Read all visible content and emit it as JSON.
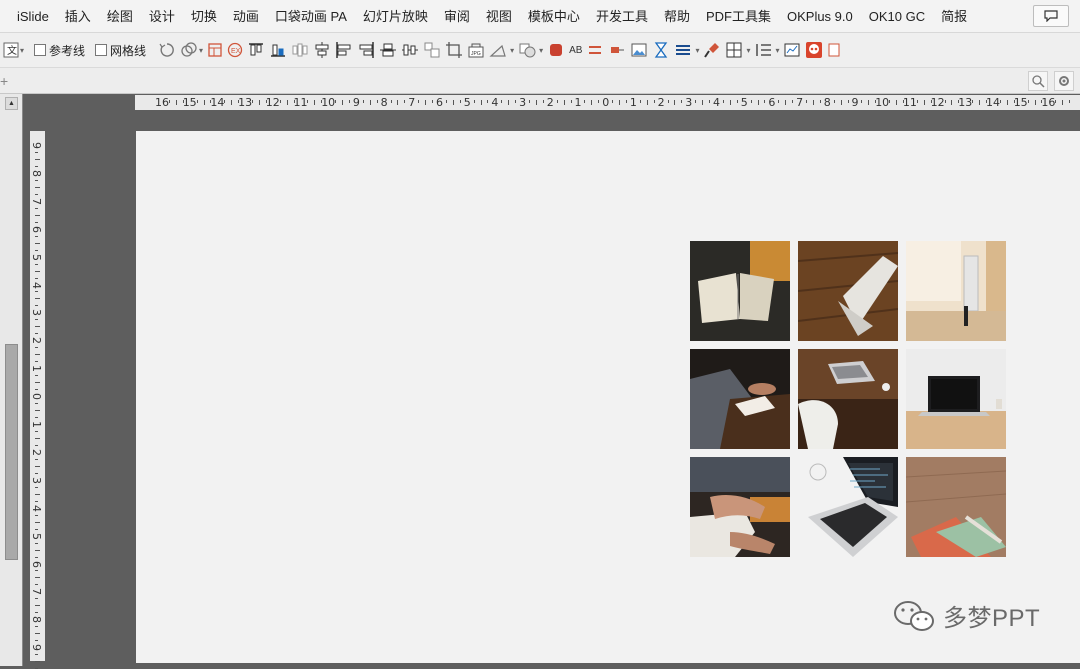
{
  "menu": [
    "iSlide",
    "插入",
    "绘图",
    "设计",
    "切换",
    "动画",
    "口袋动画 PA",
    "幻灯片放映",
    "审阅",
    "视图",
    "模板中心",
    "开发工具",
    "帮助",
    "PDF工具集",
    "OKPlus 9.0",
    "OK10 GC",
    "简报"
  ],
  "toolbar": {
    "guides_label": "参考线",
    "grid_label": "网格线",
    "ab_label": "AB"
  },
  "rulers": {
    "horizontal": [
      "16",
      "15",
      "14",
      "13",
      "12",
      "11",
      "10",
      "9",
      "8",
      "7",
      "6",
      "5",
      "4",
      "3",
      "2",
      "1",
      "0",
      "1",
      "2",
      "3",
      "4",
      "5",
      "6",
      "7",
      "8",
      "9",
      "10",
      "11",
      "12",
      "13",
      "14",
      "15",
      "16"
    ],
    "vertical": [
      "9",
      "8",
      "7",
      "6",
      "5",
      "4",
      "3",
      "2",
      "1",
      "0",
      "1",
      "2",
      "3",
      "4",
      "5",
      "6",
      "7",
      "8",
      "9"
    ]
  },
  "slide": {
    "photos": [
      "open-book-photo",
      "folded-paper-photo",
      "desk-monitor-photo",
      "meeting-hands-photo",
      "laptop-desk-photo",
      "laptop-wood-photo",
      "typing-hands-photo",
      "laptop-keyboard-photo",
      "notebook-desk-photo"
    ]
  },
  "watermark": {
    "text": "多梦PPT",
    "icon": "wechat-icon"
  }
}
